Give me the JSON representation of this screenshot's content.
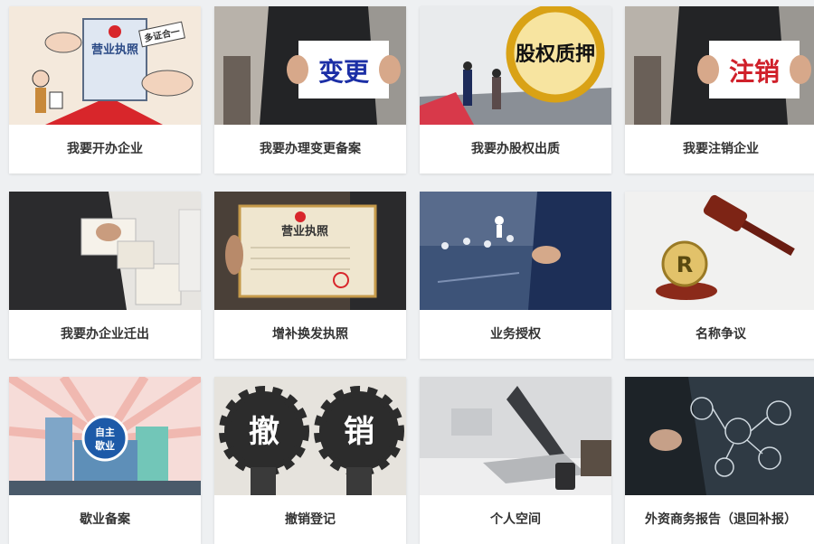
{
  "cards": [
    {
      "label": "我要开办企业",
      "icon": "business-license-icon",
      "overlay": [
        "营业执照",
        "多证合一"
      ]
    },
    {
      "label": "我要办理变更备案",
      "icon": "change-sign-icon",
      "overlay": [
        "变更"
      ]
    },
    {
      "label": "我要办股权出质",
      "icon": "equity-pledge-icon",
      "overlay": [
        "股权质押"
      ]
    },
    {
      "label": "我要注销企业",
      "icon": "cancel-sign-icon",
      "overlay": [
        "注销"
      ]
    },
    {
      "label": "我要办企业迁出",
      "icon": "relocation-boxes-icon",
      "overlay": []
    },
    {
      "label": "增补换发执照",
      "icon": "license-certificate-icon",
      "overlay": [
        "营业执照"
      ]
    },
    {
      "label": "业务授权",
      "icon": "authorization-network-icon",
      "overlay": []
    },
    {
      "label": "名称争议",
      "icon": "gavel-icon",
      "overlay": [
        "R"
      ]
    },
    {
      "label": "歇业备案",
      "icon": "suspension-building-icon",
      "overlay": [
        "自主",
        "歇业"
      ]
    },
    {
      "label": "撤销登记",
      "icon": "revocation-gears-icon",
      "overlay": [
        "撤",
        "销"
      ]
    },
    {
      "label": "个人空间",
      "icon": "laptop-icon",
      "overlay": []
    },
    {
      "label": "外资商务报告（退回补报）",
      "icon": "business-report-icon",
      "overlay": []
    }
  ]
}
